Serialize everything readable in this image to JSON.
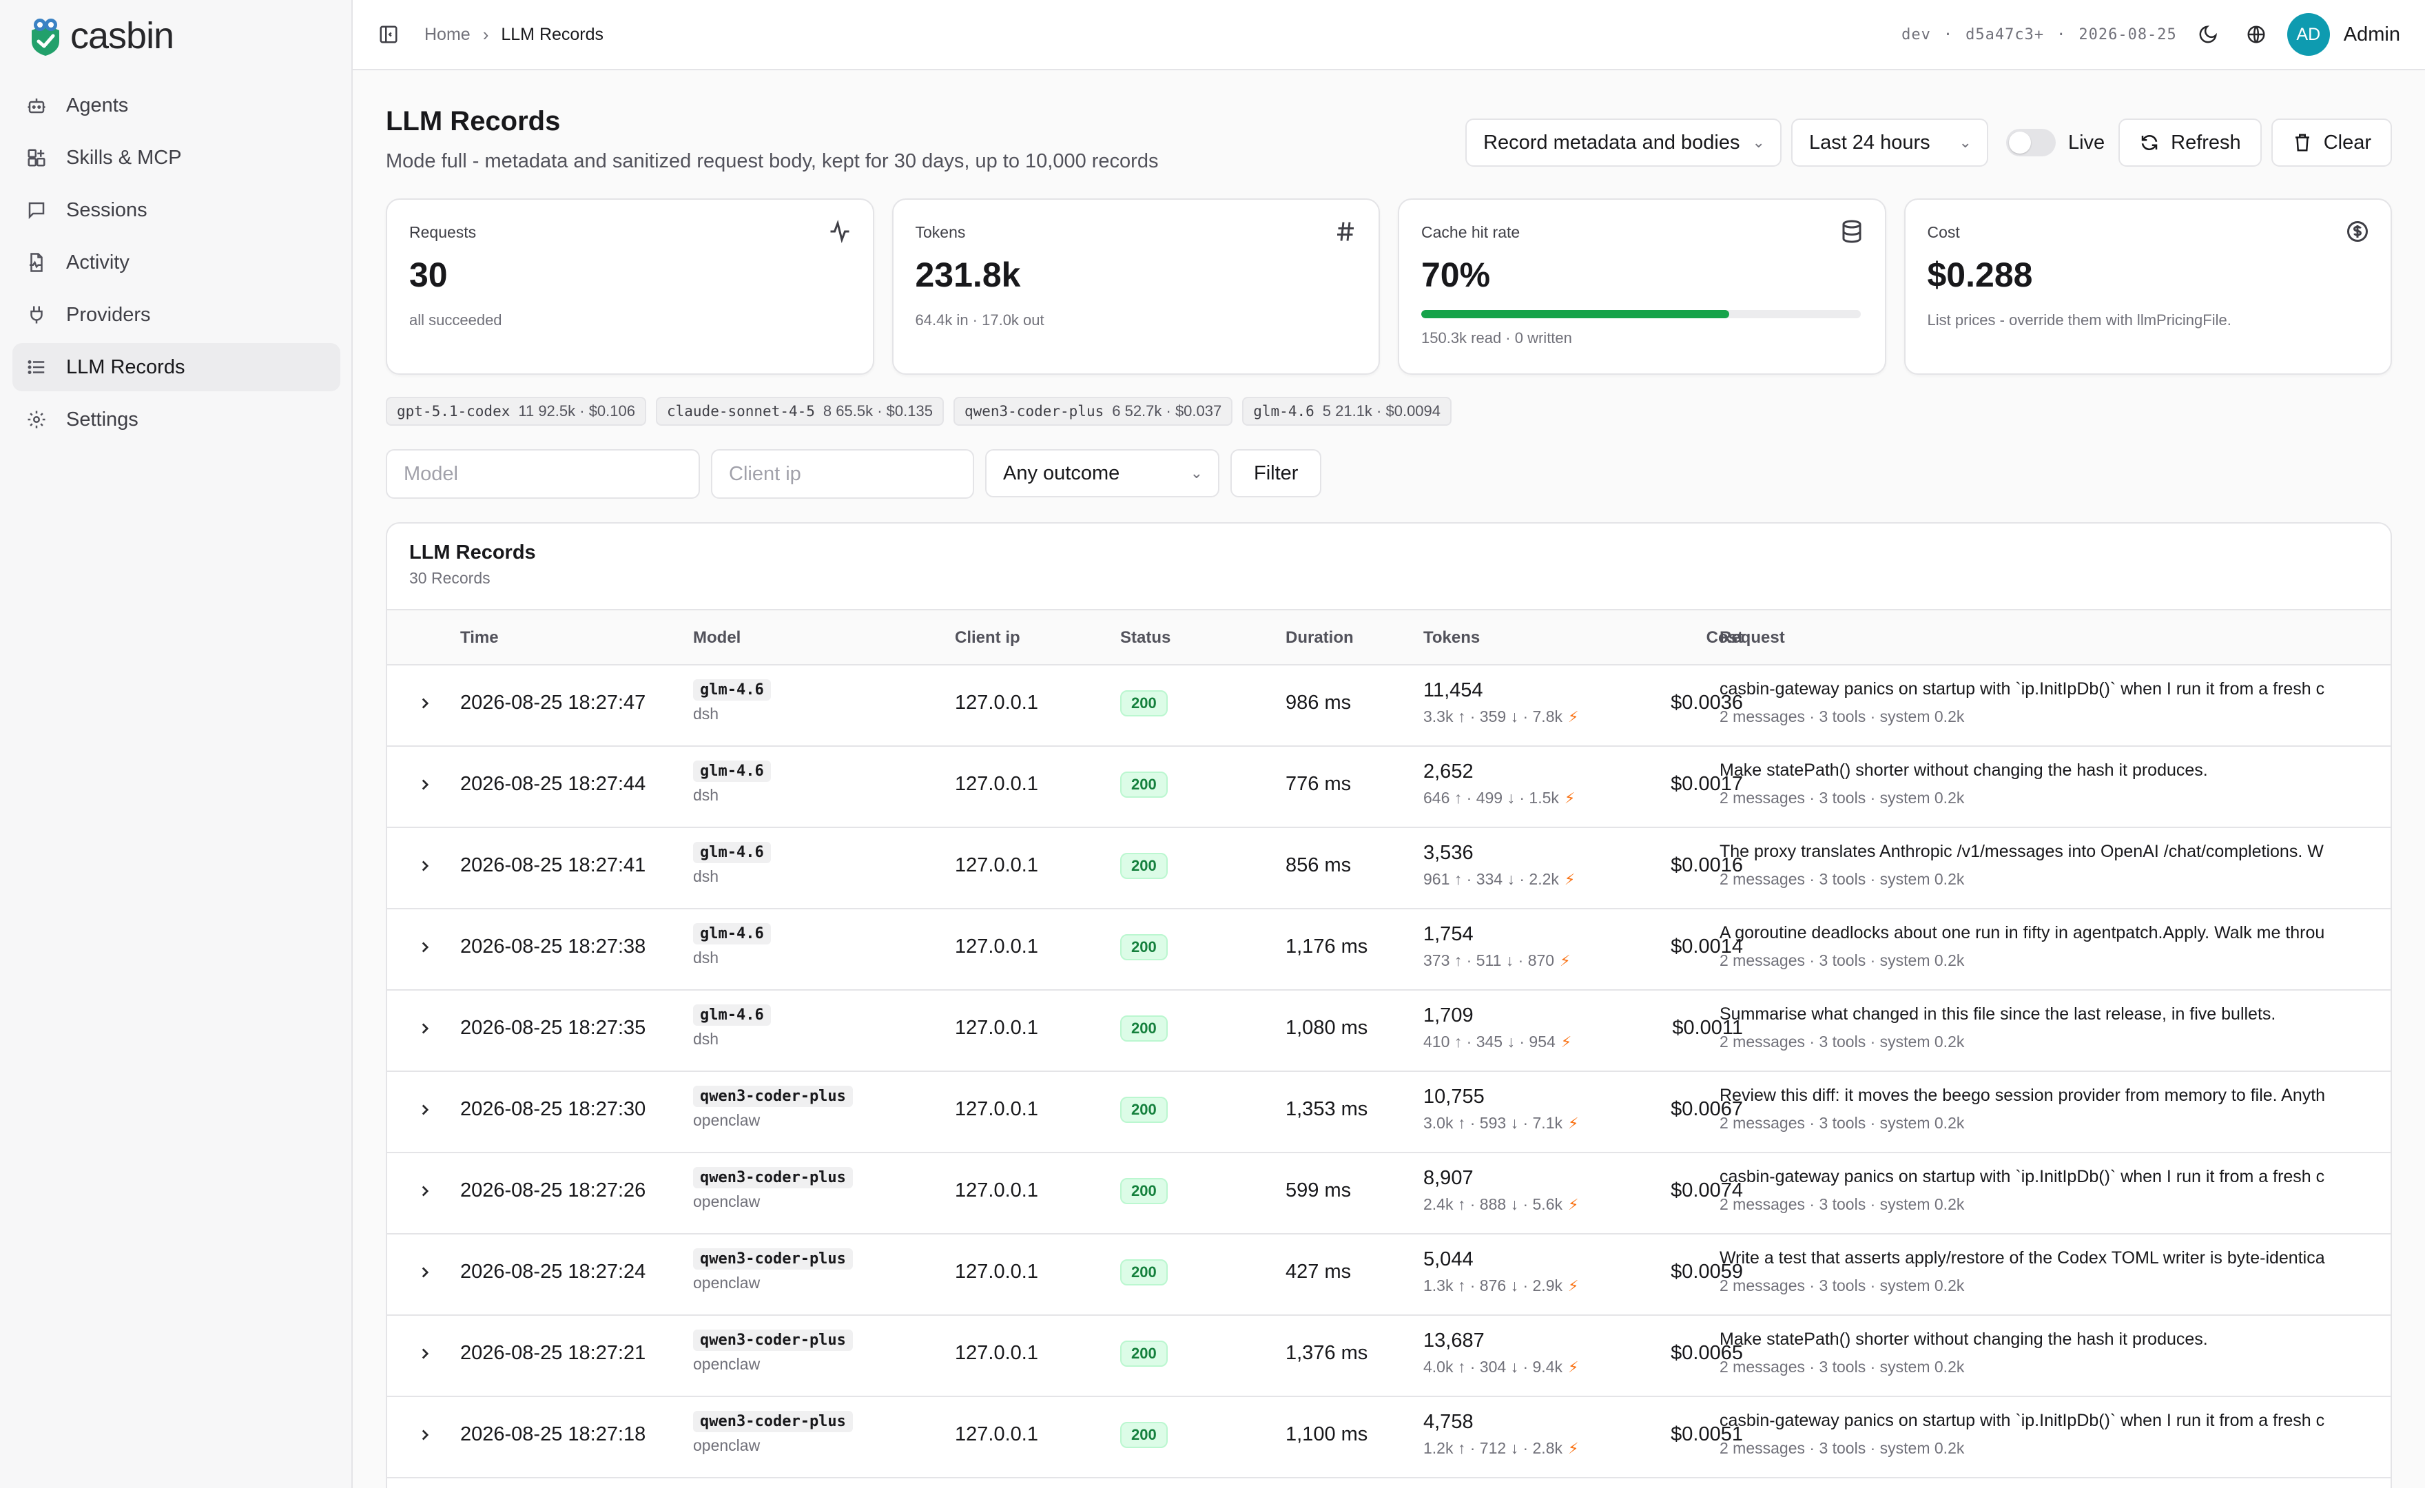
{
  "app": {
    "name": "casbin"
  },
  "sidebar": {
    "items": [
      {
        "label": "Agents",
        "icon": "robot-icon"
      },
      {
        "label": "Skills & MCP",
        "icon": "blocks-icon"
      },
      {
        "label": "Sessions",
        "icon": "chat-icon"
      },
      {
        "label": "Activity",
        "icon": "activity-file-icon"
      },
      {
        "label": "Providers",
        "icon": "plug-icon"
      },
      {
        "label": "LLM Records",
        "icon": "list-icon",
        "active": true
      },
      {
        "label": "Settings",
        "icon": "gear-icon"
      }
    ]
  },
  "topbar": {
    "breadcrumb": {
      "home": "Home",
      "current": "LLM Records"
    },
    "build": {
      "env": "dev",
      "sep1": "·",
      "commit": "d5a47c3+",
      "sep2": "·",
      "date": "2026-08-25"
    },
    "avatar_initials": "AD",
    "user": "Admin"
  },
  "page": {
    "title": "LLM Records",
    "subtitle": "Mode full - metadata and sanitized request body, kept for 30 days, up to 10,000 records"
  },
  "controls": {
    "record_mode": "Record metadata and bodies",
    "time_range": "Last 24 hours",
    "live_label": "Live",
    "live_on": false,
    "refresh_label": "Refresh",
    "clear_label": "Clear"
  },
  "stats": {
    "requests": {
      "label": "Requests",
      "value": "30",
      "note": "all succeeded"
    },
    "tokens": {
      "label": "Tokens",
      "value": "231.8k",
      "note": "64.4k in · 17.0k out"
    },
    "cache": {
      "label": "Cache hit rate",
      "value": "70%",
      "fraction": 0.7,
      "note": "150.3k read · 0 written",
      "bar_color": "#16a34a"
    },
    "cost": {
      "label": "Cost",
      "value": "$0.288",
      "note": "List prices - override them with llmPricingFile."
    }
  },
  "model_chips": [
    {
      "model": "gpt-5.1-codex",
      "summary": "11  92.5k · $0.106"
    },
    {
      "model": "claude-sonnet-4-5",
      "summary": "8  65.5k · $0.135"
    },
    {
      "model": "qwen3-coder-plus",
      "summary": "6  52.7k · $0.037"
    },
    {
      "model": "glm-4.6",
      "summary": "5  21.1k · $0.0094"
    }
  ],
  "filters": {
    "model_placeholder": "Model",
    "client_ip_placeholder": "Client ip",
    "outcome": "Any outcome",
    "filter_label": "Filter"
  },
  "table": {
    "title": "LLM Records",
    "count": "30 Records",
    "headers": {
      "time": "Time",
      "model": "Model",
      "client_ip": "Client ip",
      "status": "Status",
      "duration": "Duration",
      "tokens": "Tokens",
      "cost": "Cost",
      "request": "Request"
    },
    "rows": [
      {
        "time": "2026-08-25 18:27:47",
        "model": "glm-4.6",
        "app": "dsh",
        "ip": "127.0.0.1",
        "status": "200",
        "duration": "986 ms",
        "tokens": "11,454",
        "tok_detail": "3.3k ↑ · 359 ↓ · 7.8k",
        "cost": "$0.0036",
        "request": "casbin-gateway panics on startup with `ip.InitIpDb()` when I run it from a fresh c",
        "meta": "2 messages · 3 tools · system 0.2k"
      },
      {
        "time": "2026-08-25 18:27:44",
        "model": "glm-4.6",
        "app": "dsh",
        "ip": "127.0.0.1",
        "status": "200",
        "duration": "776 ms",
        "tokens": "2,652",
        "tok_detail": "646 ↑ · 499 ↓ · 1.5k",
        "cost": "$0.0017",
        "request": "Make statePath() shorter without changing the hash it produces.",
        "meta": "2 messages · 3 tools · system 0.2k"
      },
      {
        "time": "2026-08-25 18:27:41",
        "model": "glm-4.6",
        "app": "dsh",
        "ip": "127.0.0.1",
        "status": "200",
        "duration": "856 ms",
        "tokens": "3,536",
        "tok_detail": "961 ↑ · 334 ↓ · 2.2k",
        "cost": "$0.0016",
        "request": "The proxy translates Anthropic /v1/messages into OpenAI /chat/completions. W",
        "meta": "2 messages · 3 tools · system 0.2k"
      },
      {
        "time": "2026-08-25 18:27:38",
        "model": "glm-4.6",
        "app": "dsh",
        "ip": "127.0.0.1",
        "status": "200",
        "duration": "1,176 ms",
        "tokens": "1,754",
        "tok_detail": "373 ↑ · 511 ↓ · 870",
        "cost": "$0.0014",
        "request": "A goroutine deadlocks about one run in fifty in agentpatch.Apply. Walk me throu",
        "meta": "2 messages · 3 tools · system 0.2k"
      },
      {
        "time": "2026-08-25 18:27:35",
        "model": "glm-4.6",
        "app": "dsh",
        "ip": "127.0.0.1",
        "status": "200",
        "duration": "1,080 ms",
        "tokens": "1,709",
        "tok_detail": "410 ↑ · 345 ↓ · 954",
        "cost": "$0.0011",
        "request": "Summarise what changed in this file since the last release, in five bullets.",
        "meta": "2 messages · 3 tools · system 0.2k"
      },
      {
        "time": "2026-08-25 18:27:30",
        "model": "qwen3-coder-plus",
        "app": "openclaw",
        "ip": "127.0.0.1",
        "status": "200",
        "duration": "1,353 ms",
        "tokens": "10,755",
        "tok_detail": "3.0k ↑ · 593 ↓ · 7.1k",
        "cost": "$0.0067",
        "request": "Review this diff: it moves the beego session provider from memory to file. Anyth",
        "meta": "2 messages · 3 tools · system 0.2k"
      },
      {
        "time": "2026-08-25 18:27:26",
        "model": "qwen3-coder-plus",
        "app": "openclaw",
        "ip": "127.0.0.1",
        "status": "200",
        "duration": "599 ms",
        "tokens": "8,907",
        "tok_detail": "2.4k ↑ · 888 ↓ · 5.6k",
        "cost": "$0.0074",
        "request": "casbin-gateway panics on startup with `ip.InitIpDb()` when I run it from a fresh c",
        "meta": "2 messages · 3 tools · system 0.2k"
      },
      {
        "time": "2026-08-25 18:27:24",
        "model": "qwen3-coder-plus",
        "app": "openclaw",
        "ip": "127.0.0.1",
        "status": "200",
        "duration": "427 ms",
        "tokens": "5,044",
        "tok_detail": "1.3k ↑ · 876 ↓ · 2.9k",
        "cost": "$0.0059",
        "request": "Write a test that asserts apply/restore of the Codex TOML writer is byte-identica",
        "meta": "2 messages · 3 tools · system 0.2k"
      },
      {
        "time": "2026-08-25 18:27:21",
        "model": "qwen3-coder-plus",
        "app": "openclaw",
        "ip": "127.0.0.1",
        "status": "200",
        "duration": "1,376 ms",
        "tokens": "13,687",
        "tok_detail": "4.0k ↑ · 304 ↓ · 9.4k",
        "cost": "$0.0065",
        "request": "Make statePath() shorter without changing the hash it produces.",
        "meta": "2 messages · 3 tools · system 0.2k"
      },
      {
        "time": "2026-08-25 18:27:18",
        "model": "qwen3-coder-plus",
        "app": "openclaw",
        "ip": "127.0.0.1",
        "status": "200",
        "duration": "1,100 ms",
        "tokens": "4,758",
        "tok_detail": "1.2k ↑ · 712 ↓ · 2.8k",
        "cost": "$0.0051",
        "request": "casbin-gateway panics on startup with `ip.InitIpDb()` when I run it from a fresh c",
        "meta": "2 messages · 3 tools · system 0.2k"
      }
    ]
  }
}
